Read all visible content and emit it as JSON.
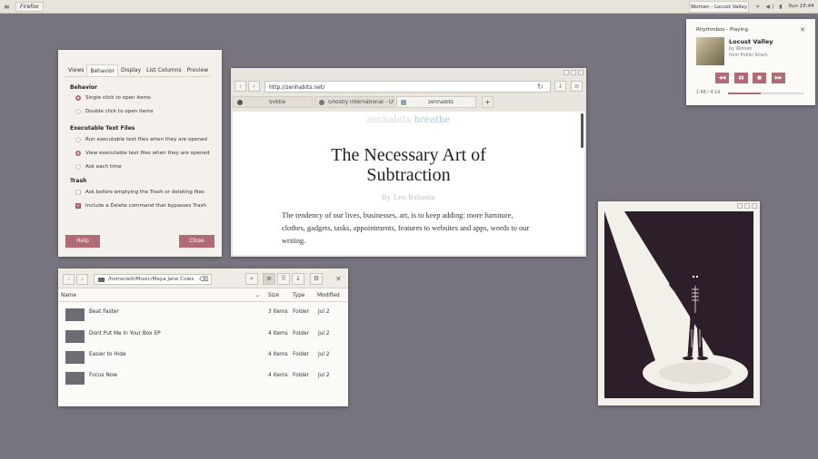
{
  "topbar": {
    "menu_glyph": "≡",
    "app_name": "Firefox",
    "now_playing": "Women - Locust Valley",
    "tray_icons": [
      "wifi-icon",
      "volume-icon",
      "battery-icon"
    ],
    "tray_text": "ᯤ ◀) ▮",
    "clock": "Sun 15:44"
  },
  "prefs": {
    "tabs": [
      "Views",
      "Behavior",
      "Display",
      "List Columns",
      "Preview"
    ],
    "behavior_title": "Behavior",
    "single_click": "Single click to open items",
    "double_click": "Double click to open items",
    "exec_title": "Executable Text Files",
    "run_exec": "Run executable text files when they are opened",
    "view_exec": "View executable text files when they are opened",
    "ask_each": "Ask each time",
    "trash_title": "Trash",
    "ask_trash": "Ask before emptying the Trash or deleting files",
    "include_delete": "Include a Delete command that bypasses Trash",
    "help": "Help",
    "close": "Close"
  },
  "browser": {
    "back": "‹",
    "forward": "›",
    "url": "http://zenhabits.net/",
    "tabs": [
      "Svbtle",
      "Ghostly International - Of...",
      "zenhabits"
    ],
    "new_tab": "+",
    "logo_left": "zenhabits",
    "logo_right": "breathe",
    "title": "The Necessary Art of Subtraction",
    "byline": "By Leo Babauta",
    "body": "The tendency of our lives, businesses, art, is to keep adding: more furniture, clothes, gadgets, tasks, appointments, features to websites and apps, words to our writing."
  },
  "files": {
    "path": "/home/will/Music/Maya Jane Coles",
    "columns": [
      "Name",
      "Size",
      "Type",
      "Modified"
    ],
    "rows": [
      {
        "name": "Beat Faster",
        "size": "3 items",
        "type": "Folder",
        "modified": "Jul 2"
      },
      {
        "name": "Dont Put Me In Your Box EP",
        "size": "4 items",
        "type": "Folder",
        "modified": "Jul 2"
      },
      {
        "name": "Easier to Hide",
        "size": "4 items",
        "type": "Folder",
        "modified": "Jul 2"
      },
      {
        "name": "Focus Now",
        "size": "4 items",
        "type": "Folder",
        "modified": "Jul 2"
      }
    ]
  },
  "rhythmbox": {
    "header": "Rhythmbox - Playing",
    "song": "Locust Valley",
    "artist": "by Women",
    "album": "from Public Strain",
    "time": "1:48 / 4:14",
    "progress": 0.43
  },
  "colors": {
    "accent": "#b06b76",
    "desktop": "#77737f"
  }
}
